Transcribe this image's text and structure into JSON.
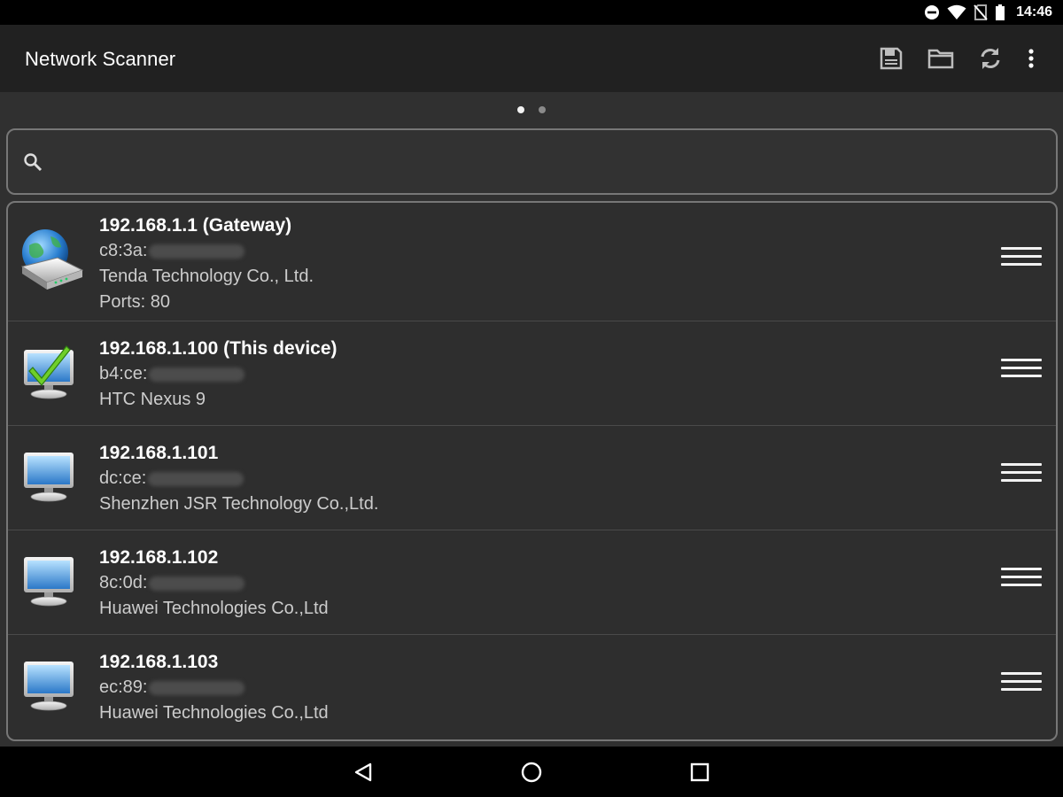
{
  "status": {
    "time": "14:46"
  },
  "appbar": {
    "title": "Network Scanner",
    "actions": [
      "save-icon",
      "folder-icon",
      "refresh-icon",
      "overflow-menu-icon"
    ]
  },
  "pager": {
    "pages": 2,
    "active": 1
  },
  "search": {
    "value": "",
    "placeholder": ""
  },
  "devices": [
    {
      "ip": "192.168.1.1 (Gateway)",
      "mac_prefix": "c8:3a:",
      "vendor": "Tenda Technology Co., Ltd.",
      "ports": "Ports: 80",
      "icon": "router-globe-icon"
    },
    {
      "ip": "192.168.1.100 (This device)",
      "mac_prefix": "b4:ce:",
      "vendor": "HTC Nexus 9",
      "icon": "monitor-check-icon"
    },
    {
      "ip": "192.168.1.101",
      "mac_prefix": "dc:ce:",
      "vendor": "Shenzhen JSR Technology Co.,Ltd.",
      "icon": "monitor-icon"
    },
    {
      "ip": "192.168.1.102",
      "mac_prefix": "8c:0d:",
      "vendor": "Huawei Technologies Co.,Ltd",
      "icon": "monitor-icon"
    },
    {
      "ip": "192.168.1.103",
      "mac_prefix": "ec:89:",
      "vendor": "Huawei Technologies Co.,Ltd",
      "icon": "monitor-icon"
    }
  ],
  "navbar": {
    "buttons": [
      "back-icon",
      "home-icon",
      "recents-icon"
    ]
  },
  "colors": {
    "background": "#303030",
    "appbar": "#212121",
    "text": "#ffffff",
    "subtext": "#cccccc",
    "border": "#777777"
  }
}
